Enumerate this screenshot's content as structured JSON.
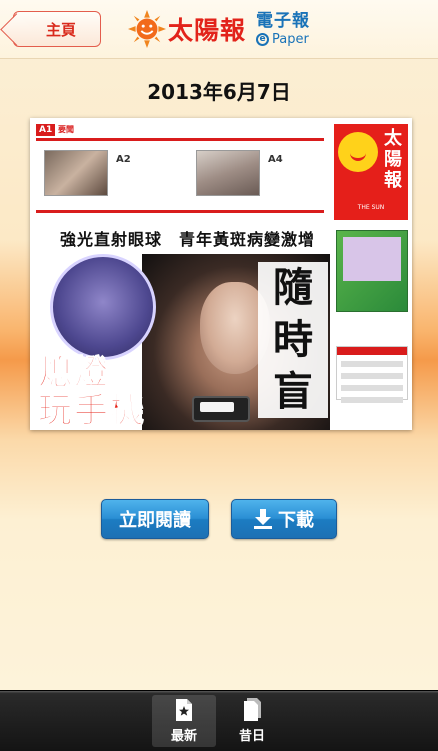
{
  "header": {
    "back_label": "主頁",
    "logo_cn": "太陽報",
    "epaper_cn": "電子報",
    "epaper_en": "Paper",
    "epaper_e": "e"
  },
  "issue_date": "2013年6月7日",
  "cover": {
    "section_tag": "A1",
    "section_label": "要聞",
    "story_a2": "A2",
    "story_a4": "A4",
    "headline_top": "強光直射眼球　青年黃斑病變激增",
    "headline_left": "熄燈\n玩手機",
    "headline_right": "隨時盲",
    "masthead": "太陽報",
    "masthead_en": "THE SUN"
  },
  "actions": {
    "read_now": "立即閱讀",
    "download": "下載"
  },
  "tabs": [
    {
      "label": "最新",
      "icon": "star-document-icon",
      "active": true
    },
    {
      "label": "昔日",
      "icon": "document-stack-icon",
      "active": false
    }
  ],
  "colors": {
    "brand_red": "#e2231a",
    "brand_blue": "#1a73b8",
    "button_blue": "#2a8fd4"
  }
}
